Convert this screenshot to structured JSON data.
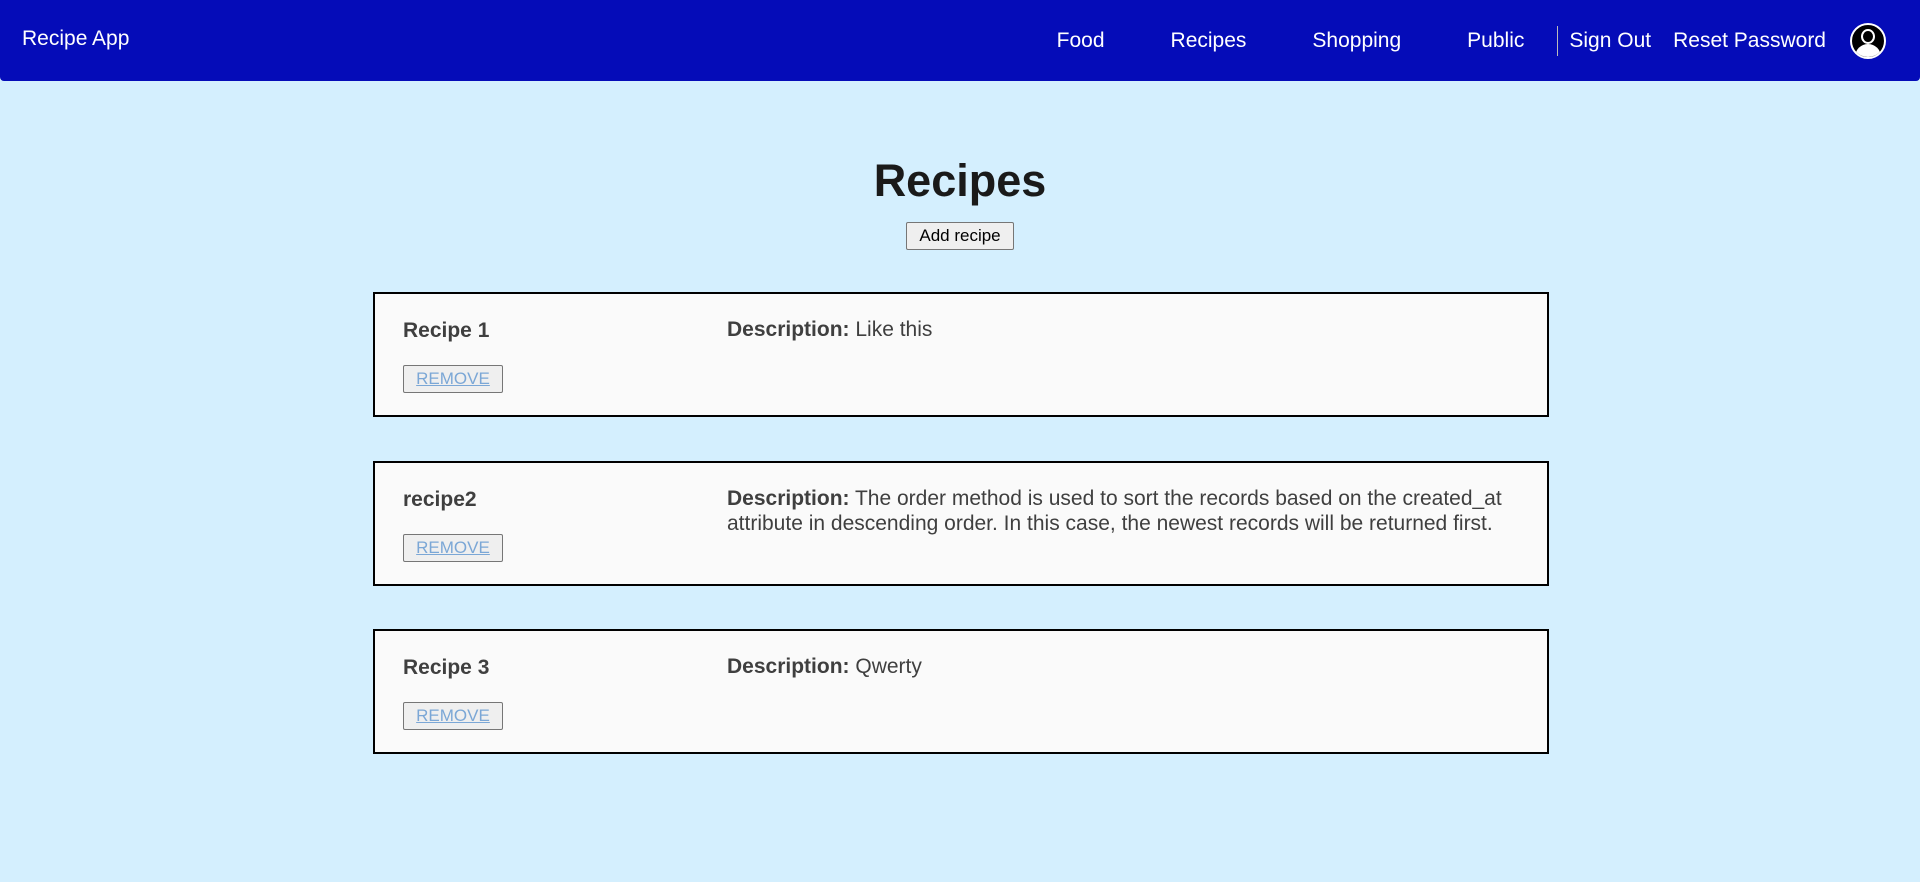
{
  "nav": {
    "brand": "Recipe App",
    "links": [
      "Food",
      "Recipes",
      "Shopping",
      "Public"
    ],
    "sign_out": "Sign Out",
    "reset_password": "Reset Password",
    "avatar_icon": "user-avatar-icon"
  },
  "page": {
    "title": "Recipes",
    "add_button": "Add recipe"
  },
  "recipes": [
    {
      "name": "Recipe 1",
      "description_label": "Description:",
      "description": "Like this",
      "remove": "REMOVE"
    },
    {
      "name": "recipe2",
      "description_label": "Description:",
      "description": "The order method is used to sort the records based on the created_at attribute in descending order. In this case, the newest records will be returned first.",
      "remove": "REMOVE"
    },
    {
      "name": "Recipe 3",
      "description_label": "Description:",
      "description": "Qwerty",
      "remove": "REMOVE"
    }
  ]
}
